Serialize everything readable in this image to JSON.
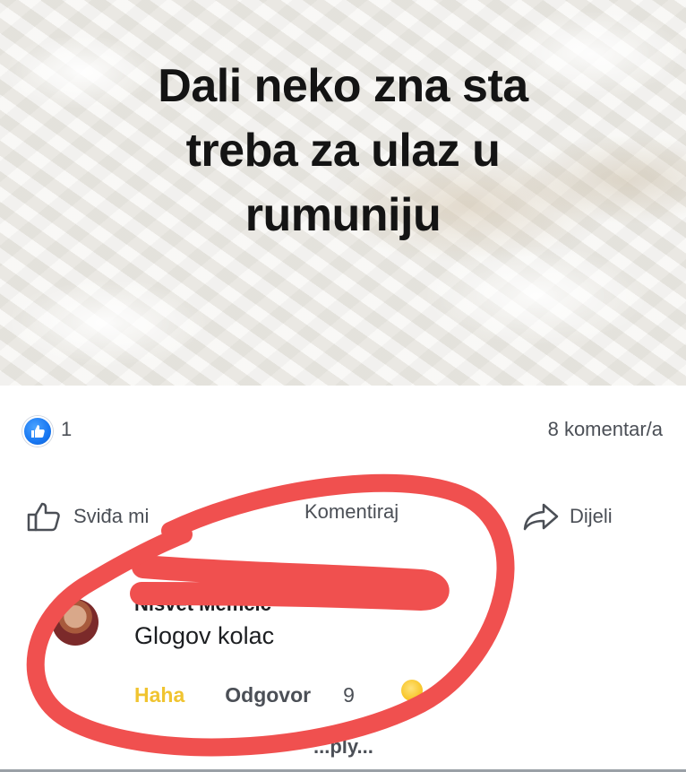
{
  "post": {
    "text_lines": [
      "Dali neko zna sta",
      "treba za ulaz u",
      "rumuniju"
    ]
  },
  "reactions": {
    "like_count": "1",
    "comment_count": "8 komentar/a",
    "like_icon": "thumbs-up-icon",
    "like_color": "#1877f2"
  },
  "actions": {
    "like_label": "Sviđa mi",
    "comment_label": "Komentiraj",
    "share_label": "Dijeli",
    "like_icon": "thumbs-up-outline-icon",
    "comment_icon": "comment-icon",
    "share_icon": "share-arrow-icon"
  },
  "comment": {
    "author": "Nisvet Memcic",
    "body": "Glogov kolac",
    "haha_label": "Haha",
    "reply_label": "Odgovor",
    "reaction_count": "9",
    "reaction_icon": "haha-emoji-icon",
    "more_replies": "...ply..."
  },
  "annotation": {
    "circle_color": "#f0504f",
    "marker_color": "#f0504f"
  }
}
